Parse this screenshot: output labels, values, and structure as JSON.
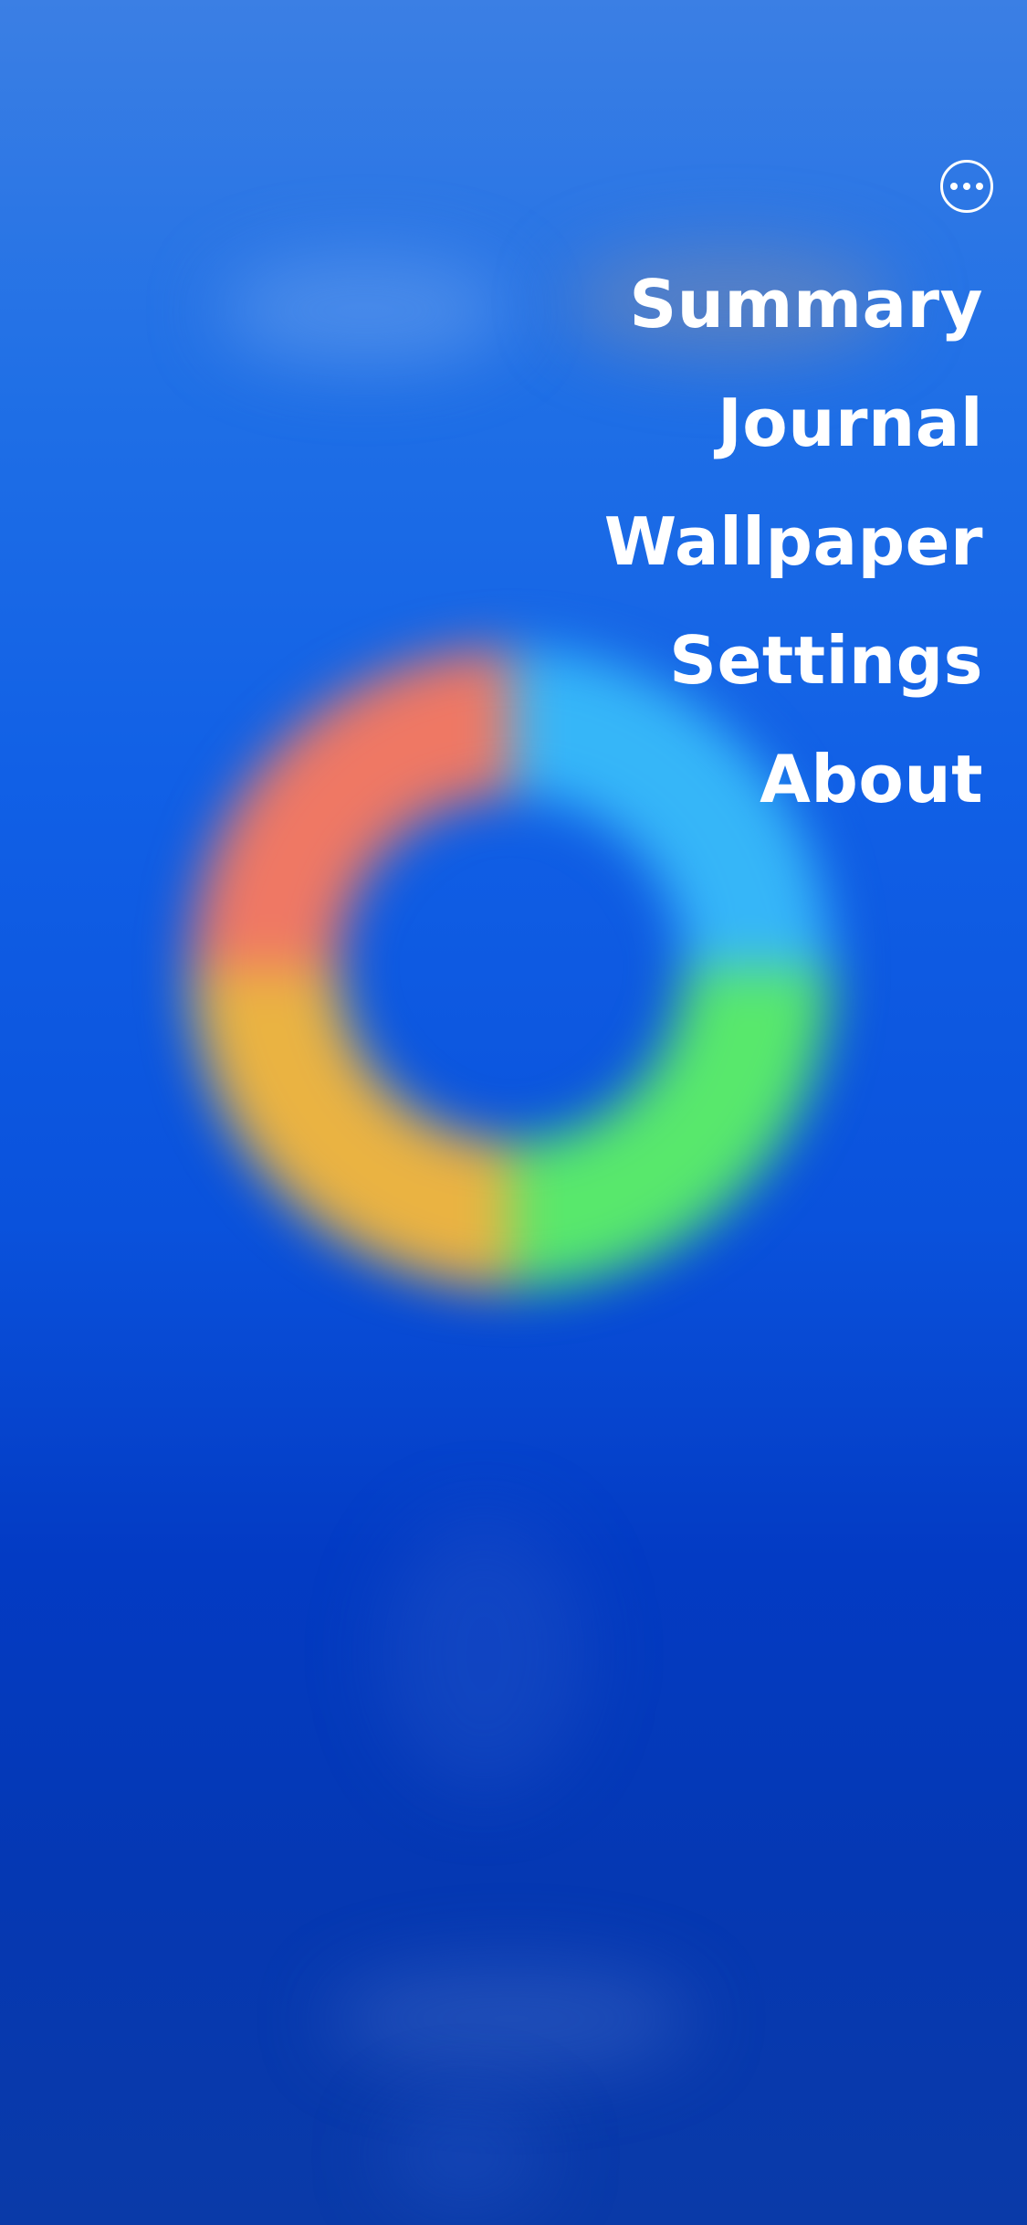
{
  "menu_button": {
    "icon": "more-horizontal-icon"
  },
  "menu": {
    "items": [
      {
        "label": "Summary"
      },
      {
        "label": "Journal"
      },
      {
        "label": "Wallpaper"
      },
      {
        "label": "Settings"
      },
      {
        "label": "About"
      }
    ]
  },
  "colors": {
    "ring_red": "#ef7864",
    "ring_cyan": "#36b6f8",
    "ring_green": "#58e86c",
    "ring_yellow": "#eab342",
    "text": "#ffffff"
  }
}
